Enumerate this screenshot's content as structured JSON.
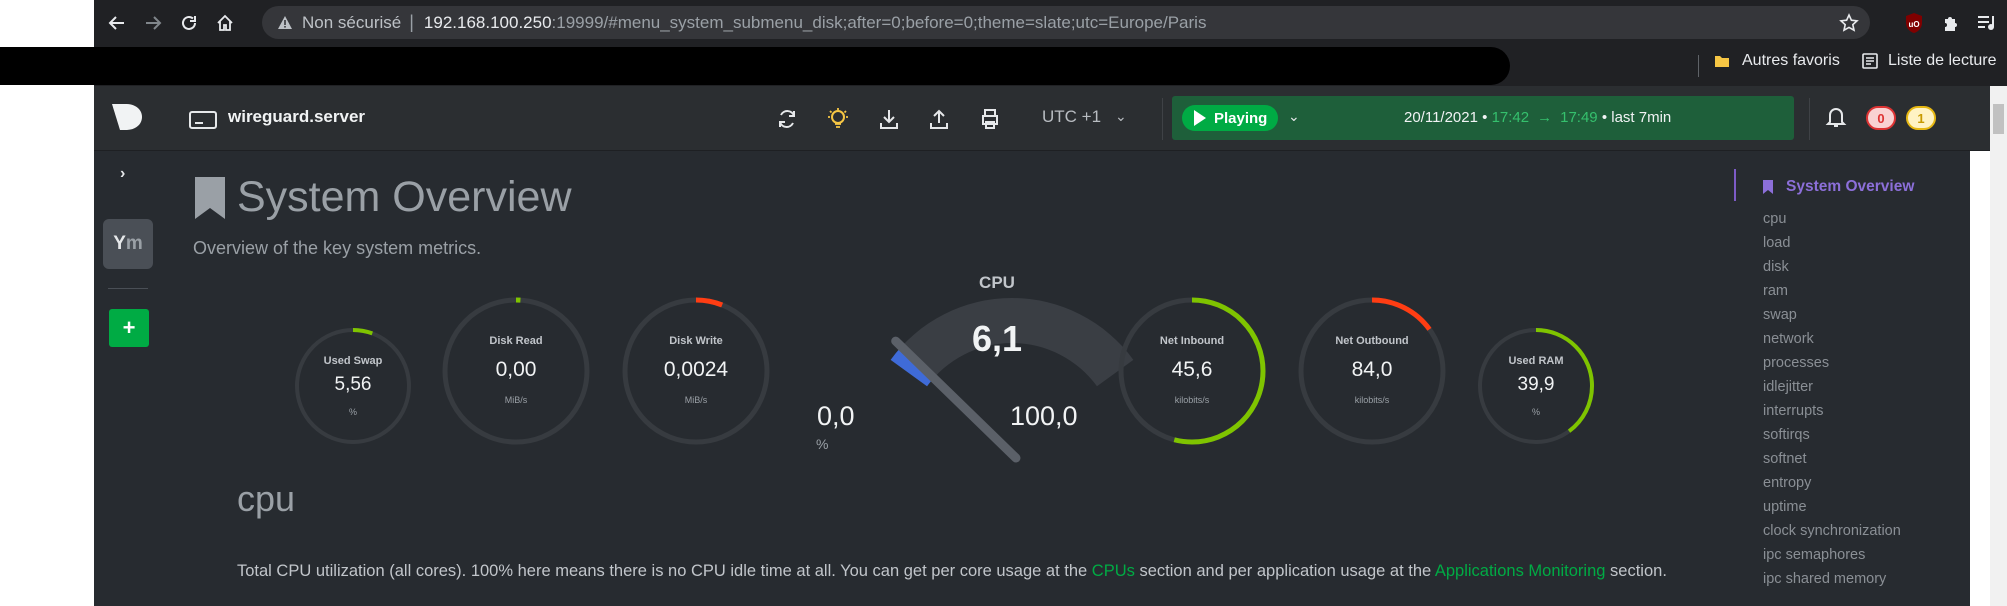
{
  "browser": {
    "security_label": "Non sécurisé",
    "url_host": "192.168.100.250",
    "url_rest": ":19999/#menu_system_submenu_disk;after=0;before=0;theme=slate;utc=Europe/Paris",
    "bookmarks": {
      "other_favorites": "Autres favoris",
      "reading_list": "Liste de lecture"
    }
  },
  "header": {
    "hostname": "wireguard.server",
    "timezone": "UTC +1",
    "play_label": "Playing",
    "date": "20/11/2021",
    "time_from": "17:42",
    "time_to": "17:49",
    "window": "last 7min",
    "alarms_critical": "0",
    "alarms_warning": "1"
  },
  "sidebar": {
    "space_initials_a": "Y",
    "space_initials_b": "m",
    "add_label": "+"
  },
  "page": {
    "title": "System Overview",
    "subtitle": "Overview of the key system metrics."
  },
  "gauges": [
    {
      "title": "Used Swap",
      "value": "5,56",
      "unit": "%",
      "fraction": 0.056,
      "color": "#7fc400"
    },
    {
      "title": "Disk Read",
      "value": "0,00",
      "unit": "MiB/s",
      "fraction": 0.01,
      "color": "#7fc400"
    },
    {
      "title": "Disk Write",
      "value": "0,0024",
      "unit": "MiB/s",
      "fraction": 0.06,
      "color": "#ff3d13"
    },
    {
      "title": "Net Inbound",
      "value": "45,6",
      "unit": "kilobits/s",
      "fraction": 0.54,
      "color": "#7fc400"
    },
    {
      "title": "Net Outbound",
      "value": "84,0",
      "unit": "kilobits/s",
      "fraction": 0.15,
      "color": "#ff3d13"
    },
    {
      "title": "Used RAM",
      "value": "39,9",
      "unit": "%",
      "fraction": 0.399,
      "color": "#7fc400"
    }
  ],
  "cpu_gauge": {
    "title": "CPU",
    "value": "6,1",
    "min": "0,0",
    "max": "100,0",
    "unit": "%",
    "fraction": 0.061
  },
  "section": {
    "title": "cpu",
    "desc_1": "Total CPU utilization (all cores). 100% here means there is no CPU idle time at all. You can get per core usage at the ",
    "link_cpus": "CPUs",
    "desc_2": " section and per application usage at the ",
    "link_apps": "Applications Monitoring",
    "desc_3": " section."
  },
  "toc": {
    "active": "System Overview",
    "items": [
      "cpu",
      "load",
      "disk",
      "ram",
      "swap",
      "network",
      "processes",
      "idlejitter",
      "interrupts",
      "softirqs",
      "softnet",
      "entropy",
      "uptime",
      "clock synchronization",
      "ipc semaphores",
      "ipc shared memory"
    ]
  },
  "colors": {
    "accent_green": "#00ab44",
    "accent_purple": "#8c6fd9",
    "gauge_track": "#373b40"
  }
}
